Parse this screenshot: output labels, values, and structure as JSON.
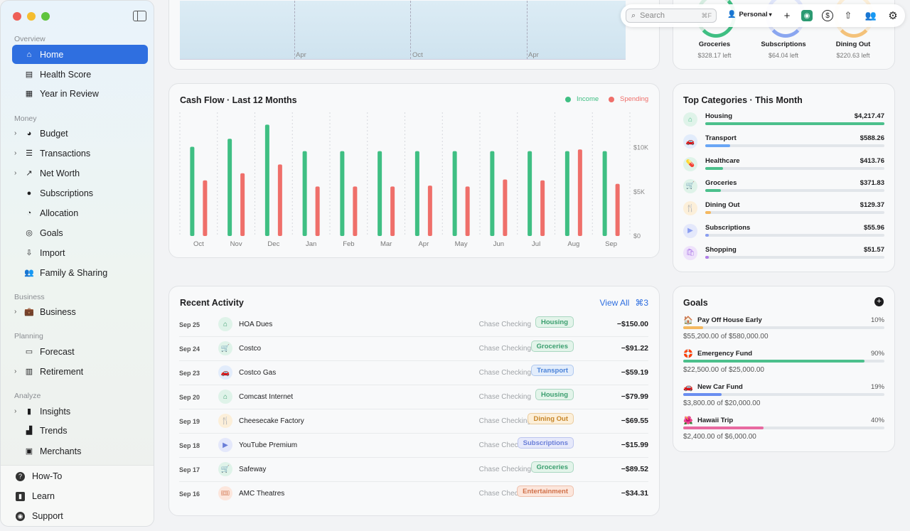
{
  "sidebar": {
    "sections": {
      "overview": "Overview",
      "money": "Money",
      "business": "Business",
      "planning": "Planning",
      "analyze": "Analyze"
    },
    "items": {
      "home": "Home",
      "health": "Health Score",
      "year": "Year in Review",
      "budget": "Budget",
      "transactions": "Transactions",
      "networth": "Net Worth",
      "subscriptions": "Subscriptions",
      "allocation": "Allocation",
      "goals": "Goals",
      "import": "Import",
      "family": "Family & Sharing",
      "business": "Business",
      "forecast": "Forecast",
      "retirement": "Retirement",
      "insights": "Insights",
      "trends": "Trends",
      "merchants": "Merchants"
    },
    "bottom": {
      "howto": "How-To",
      "learn": "Learn",
      "support": "Support"
    }
  },
  "toolbar": {
    "search_placeholder": "Search",
    "search_shortcut": "⌘F",
    "profile": "Personal"
  },
  "top_chart": {
    "ticks": [
      "Apr",
      "Oct",
      "Apr"
    ]
  },
  "budgets": [
    {
      "name": "Groceries",
      "left": "$328.17 left",
      "color": "#3fbf83"
    },
    {
      "name": "Subscriptions",
      "left": "$64.04 left",
      "color": "#8aa6f0"
    },
    {
      "name": "Dining Out",
      "left": "$220.63 left",
      "color": "#f4c27a"
    }
  ],
  "cashflow": {
    "title": "Cash Flow · Last 12 Months",
    "legend_income": "Income",
    "legend_spending": "Spending"
  },
  "chart_data": {
    "type": "bar",
    "title": "Cash Flow · Last 12 Months",
    "categories": [
      "Oct",
      "Nov",
      "Dec",
      "Jan",
      "Feb",
      "Mar",
      "Apr",
      "May",
      "Jun",
      "Jul",
      "Aug",
      "Sep"
    ],
    "series": [
      {
        "name": "Income",
        "color": "#3fbf83",
        "values": [
          10100,
          11000,
          12600,
          9600,
          9600,
          9600,
          9600,
          9600,
          9600,
          9600,
          9600,
          9600
        ]
      },
      {
        "name": "Spending",
        "color": "#ef6f6a",
        "values": [
          6300,
          7100,
          8100,
          5600,
          5600,
          5600,
          5700,
          5600,
          6400,
          6300,
          9800,
          5900
        ]
      }
    ],
    "yticks": [
      "$0",
      "$5K",
      "$10K"
    ],
    "ylim": [
      0,
      14000
    ],
    "grid": true,
    "legend": "top-right"
  },
  "categories": {
    "title": "Top Categories · This Month",
    "items": [
      {
        "name": "Housing",
        "amount": "$4,217.47",
        "pct": 1.0,
        "color": "#4cc08c",
        "bg": "#dff3e9",
        "icon": "⌂"
      },
      {
        "name": "Transport",
        "amount": "$588.26",
        "pct": 0.14,
        "color": "#6aa6f5",
        "bg": "#e2ecfb",
        "icon": "🚗"
      },
      {
        "name": "Healthcare",
        "amount": "$413.76",
        "pct": 0.1,
        "color": "#4cc08c",
        "bg": "#dff3e9",
        "icon": "💊"
      },
      {
        "name": "Groceries",
        "amount": "$371.83",
        "pct": 0.088,
        "color": "#4cc08c",
        "bg": "#dff3e9",
        "icon": "🛒"
      },
      {
        "name": "Dining Out",
        "amount": "$129.37",
        "pct": 0.031,
        "color": "#f4b860",
        "bg": "#fcefd9",
        "icon": "🍴"
      },
      {
        "name": "Subscriptions",
        "amount": "$55.96",
        "pct": 0.013,
        "color": "#8a9ef0",
        "bg": "#e4e8fb",
        "icon": "▶"
      },
      {
        "name": "Shopping",
        "amount": "$51.57",
        "pct": 0.012,
        "color": "#b07ee8",
        "bg": "#eee2fb",
        "icon": "🛍"
      }
    ]
  },
  "activity": {
    "title": "Recent Activity",
    "view_all": "View All",
    "shortcut": "⌘3",
    "rows": [
      {
        "date": "Sep 25",
        "name": "HOA Dues",
        "account": "Chase Checking",
        "tag": "Housing",
        "amount": "−$150.00",
        "tagColor": "#3a9e6e",
        "tagBg": "#e3f4ea",
        "icon": "⌂",
        "iconBg": "#dff3e9"
      },
      {
        "date": "Sep 24",
        "name": "Costco",
        "account": "Chase Checking",
        "tag": "Groceries",
        "amount": "−$91.22",
        "tagColor": "#3a9e6e",
        "tagBg": "#e3f4ea",
        "icon": "🛒",
        "iconBg": "#dff3e9"
      },
      {
        "date": "Sep 23",
        "name": "Costco Gas",
        "account": "Chase Checking",
        "tag": "Transport",
        "amount": "−$59.19",
        "tagColor": "#4a82d8",
        "tagBg": "#e3edfb",
        "icon": "🚗",
        "iconBg": "#e2ecfb"
      },
      {
        "date": "Sep 20",
        "name": "Comcast Internet",
        "account": "Chase Checking",
        "tag": "Housing",
        "amount": "−$79.99",
        "tagColor": "#3a9e6e",
        "tagBg": "#e3f4ea",
        "icon": "⌂",
        "iconBg": "#dff3e9"
      },
      {
        "date": "Sep 19",
        "name": "Cheesecake Factory",
        "account": "Chase Checking",
        "tag": "Dining Out",
        "amount": "−$69.55",
        "tagColor": "#c7862a",
        "tagBg": "#fcefd9",
        "icon": "🍴",
        "iconBg": "#fcefd9"
      },
      {
        "date": "Sep 18",
        "name": "YouTube Premium",
        "account": "Chase Checking",
        "tag": "Subscriptions",
        "amount": "−$15.99",
        "tagColor": "#6a7ed8",
        "tagBg": "#e6e9fb",
        "icon": "▶",
        "iconBg": "#e4e8fb"
      },
      {
        "date": "Sep 17",
        "name": "Safeway",
        "account": "Chase Checking",
        "tag": "Groceries",
        "amount": "−$89.52",
        "tagColor": "#3a9e6e",
        "tagBg": "#e3f4ea",
        "icon": "🛒",
        "iconBg": "#dff3e9"
      },
      {
        "date": "Sep 16",
        "name": "AMC Theatres",
        "account": "Chase Checking",
        "tag": "Entertainment",
        "amount": "−$34.31",
        "tagColor": "#d0714a",
        "tagBg": "#fce6dc",
        "icon": "🎟",
        "iconBg": "#fce6dc"
      }
    ]
  },
  "goals": {
    "title": "Goals",
    "items": [
      {
        "icon": "🏠",
        "name": "Pay Off House Early",
        "pct": "10%",
        "progress": 0.1,
        "sub": "$55,200.00 of $580,000.00",
        "color": "#f4b860"
      },
      {
        "icon": "🛟",
        "name": "Emergency Fund",
        "pct": "90%",
        "progress": 0.9,
        "sub": "$22,500.00 of $25,000.00",
        "color": "#4cc08c"
      },
      {
        "icon": "🚗",
        "name": "New Car Fund",
        "pct": "19%",
        "progress": 0.19,
        "sub": "$3,800.00 of $20,000.00",
        "color": "#6a8ef0"
      },
      {
        "icon": "🌺",
        "name": "Hawaii Trip",
        "pct": "40%",
        "progress": 0.4,
        "sub": "$2,400.00 of $6,000.00",
        "color": "#e86aa0"
      }
    ]
  }
}
